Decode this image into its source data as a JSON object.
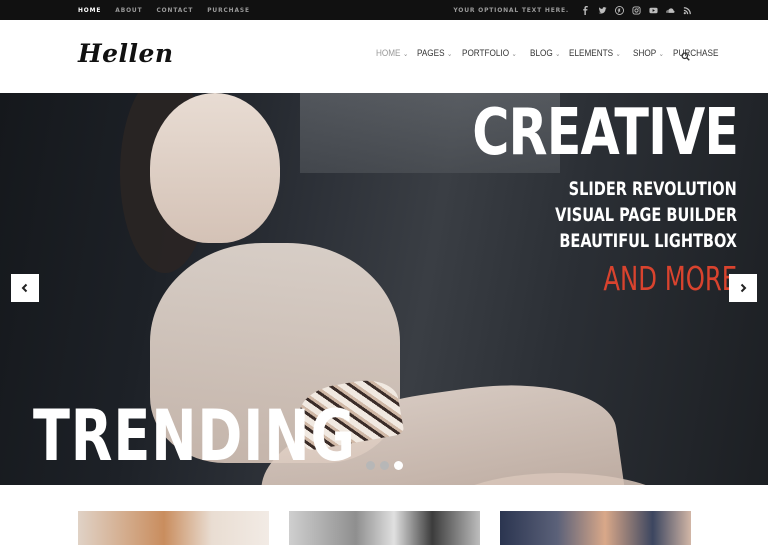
{
  "topbar": {
    "nav": [
      "HOME",
      "ABOUT",
      "CONTACT",
      "PURCHASE"
    ],
    "optional_text": "YOUR OPTIONAL TEXT HERE.",
    "social_icons": [
      "facebook-icon",
      "twitter-icon",
      "pinterest-icon",
      "instagram-icon",
      "youtube-icon",
      "soundcloud-icon",
      "rss-icon"
    ]
  },
  "header": {
    "logo": "Hellen",
    "nav": [
      {
        "label": "HOME",
        "has_dropdown": true
      },
      {
        "label": "PAGES",
        "has_dropdown": true
      },
      {
        "label": "PORTFOLIO",
        "has_dropdown": true
      },
      {
        "label": "BLOG",
        "has_dropdown": true
      },
      {
        "label": "ELEMENTS",
        "has_dropdown": true
      },
      {
        "label": "SHOP",
        "has_dropdown": true
      },
      {
        "label": "PURCHASE",
        "has_dropdown": false
      }
    ],
    "chevron": "⌄"
  },
  "hero": {
    "title": "CREATIVE",
    "line1": "SLIDER REVOLUTION",
    "line2": "VISUAL PAGE BUILDER",
    "line3": "BEAUTIFUL LIGHTBOX",
    "highlight": "AND MORE",
    "bottom_title": "TRENDING",
    "slides_total": 3,
    "active_slide": 3,
    "accent_color": "#d9432e"
  }
}
